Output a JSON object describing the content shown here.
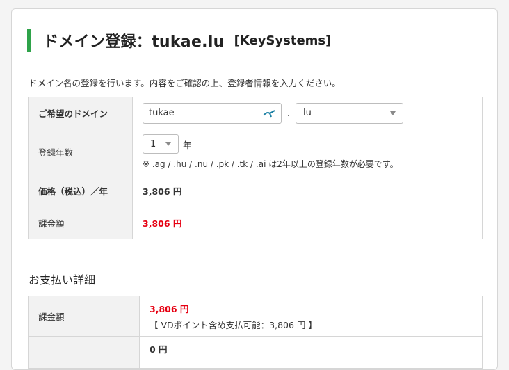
{
  "header": {
    "title": "ドメイン登録：tukae.lu",
    "provider": "[KeySystems]"
  },
  "intro": "ドメイン名の登録を行います。内容をご確認の上、登録者情報を入力ください。",
  "form": {
    "domain_label": "ご希望のドメイン",
    "domain_value": "tukae",
    "dot": ".",
    "tld_value": "lu",
    "years_label": "登録年数",
    "years_value": "1",
    "years_unit": "年",
    "years_note": "※ .ag / .hu / .nu / .pk / .tk / .ai は2年以上の登録年数が必要です。",
    "price_label": "価格（税込）／年",
    "price_value": "3,806 円",
    "charge_label": "課金額",
    "charge_value": "3,806 円"
  },
  "payment": {
    "section_title": "お支払い詳細",
    "charge_label": "課金額",
    "charge_value": "3,806 円",
    "vd_note": "【 VDポイント含め支払可能：3,806 円 】",
    "next_value": "0 円"
  },
  "colors": {
    "accent": "#2fa34a",
    "price_red": "#e60012",
    "label_bg": "#f2f2f2",
    "autofill_icon": "#1a7fa3"
  },
  "icons": {
    "autofill": "autofill-key-icon",
    "select_caret": "caret-down-icon"
  }
}
